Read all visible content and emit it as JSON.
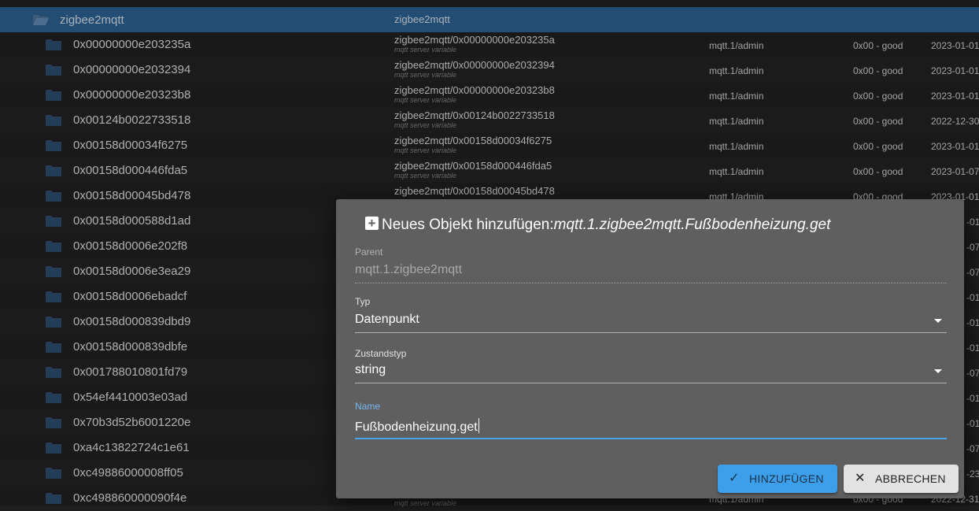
{
  "tree": {
    "top": {
      "name": "zigbee2mqtt",
      "id": "zigbee2mqtt"
    },
    "rows": [
      {
        "name": "0x00000000e203235a",
        "id": "zigbee2mqtt/0x00000000e203235a",
        "sub": "mqtt server variable",
        "user": "mqtt.1/admin",
        "status": "0x00 - good",
        "date": "2023-01-01"
      },
      {
        "name": "0x00000000e2032394",
        "id": "zigbee2mqtt/0x00000000e2032394",
        "sub": "mqtt server variable",
        "user": "mqtt.1/admin",
        "status": "0x00 - good",
        "date": "2023-01-01"
      },
      {
        "name": "0x00000000e20323b8",
        "id": "zigbee2mqtt/0x00000000e20323b8",
        "sub": "mqtt server variable",
        "user": "mqtt.1/admin",
        "status": "0x00 - good",
        "date": "2023-01-01"
      },
      {
        "name": "0x00124b0022733518",
        "id": "zigbee2mqtt/0x00124b0022733518",
        "sub": "mqtt server variable",
        "user": "mqtt.1/admin",
        "status": "0x00 - good",
        "date": "2022-12-30"
      },
      {
        "name": "0x00158d00034f6275",
        "id": "zigbee2mqtt/0x00158d00034f6275",
        "sub": "mqtt server variable",
        "user": "mqtt.1/admin",
        "status": "0x00 - good",
        "date": "2023-01-01"
      },
      {
        "name": "0x00158d000446fda5",
        "id": "zigbee2mqtt/0x00158d000446fda5",
        "sub": "mqtt server variable",
        "user": "mqtt.1/admin",
        "status": "0x00 - good",
        "date": "2023-01-07"
      },
      {
        "name": "0x00158d00045bd478",
        "id": "zigbee2mqtt/0x00158d00045bd478",
        "sub": "",
        "user": "mqtt.1/admin",
        "status": "0x00 - good",
        "date": "2023-01-01"
      },
      {
        "name": "0x00158d000588d1ad",
        "id": "",
        "sub": "",
        "user": "",
        "status": "",
        "date": "-01"
      },
      {
        "name": "0x00158d0006e202f8",
        "id": "",
        "sub": "",
        "user": "",
        "status": "",
        "date": "-07"
      },
      {
        "name": "0x00158d0006e3ea29",
        "id": "",
        "sub": "",
        "user": "",
        "status": "",
        "date": "-07"
      },
      {
        "name": "0x00158d0006ebadcf",
        "id": "",
        "sub": "",
        "user": "",
        "status": "",
        "date": "-01"
      },
      {
        "name": "0x00158d000839dbd9",
        "id": "",
        "sub": "",
        "user": "",
        "status": "",
        "date": "-01"
      },
      {
        "name": "0x00158d000839dbfe",
        "id": "",
        "sub": "",
        "user": "",
        "status": "",
        "date": "-01"
      },
      {
        "name": "0x001788010801fd79",
        "id": "",
        "sub": "",
        "user": "",
        "status": "",
        "date": "-07"
      },
      {
        "name": "0x54ef4410003e03ad",
        "id": "",
        "sub": "",
        "user": "",
        "status": "",
        "date": "-01"
      },
      {
        "name": "0x70b3d52b6001220e",
        "id": "",
        "sub": "",
        "user": "",
        "status": "",
        "date": "-01"
      },
      {
        "name": "0xa4c13822724c1e61",
        "id": "",
        "sub": "",
        "user": "",
        "status": "",
        "date": "-07"
      },
      {
        "name": "0xc49886000008ff05",
        "id": "",
        "sub": "",
        "user": "",
        "status": "",
        "date": "-23"
      },
      {
        "name": "0xc498860000090f4e",
        "id": "",
        "sub": "mqtt server variable",
        "user": "mqtt.1/admin",
        "status": "0x00 - good",
        "date": "2022-12-31"
      }
    ]
  },
  "dialog": {
    "title_prefix": "Neues Objekt hinzufügen:",
    "title_object": "mqtt.1.zigbee2mqtt.Fußbodenheizung.get",
    "parent_label": "Parent",
    "parent_value": "mqtt.1.zigbee2mqtt",
    "type_label": "Typ",
    "type_value": "Datenpunkt",
    "statetype_label": "Zustandstyp",
    "statetype_value": "string",
    "name_label": "Name",
    "name_value": "Fußbodenheizung.get",
    "add_button": "HINZUFÜGEN",
    "cancel_button": "ABBRECHEN"
  },
  "colors": {
    "accent": "#3d9ee9",
    "selected_row": "#2d5f8e",
    "folder": "#2b4a6b"
  }
}
